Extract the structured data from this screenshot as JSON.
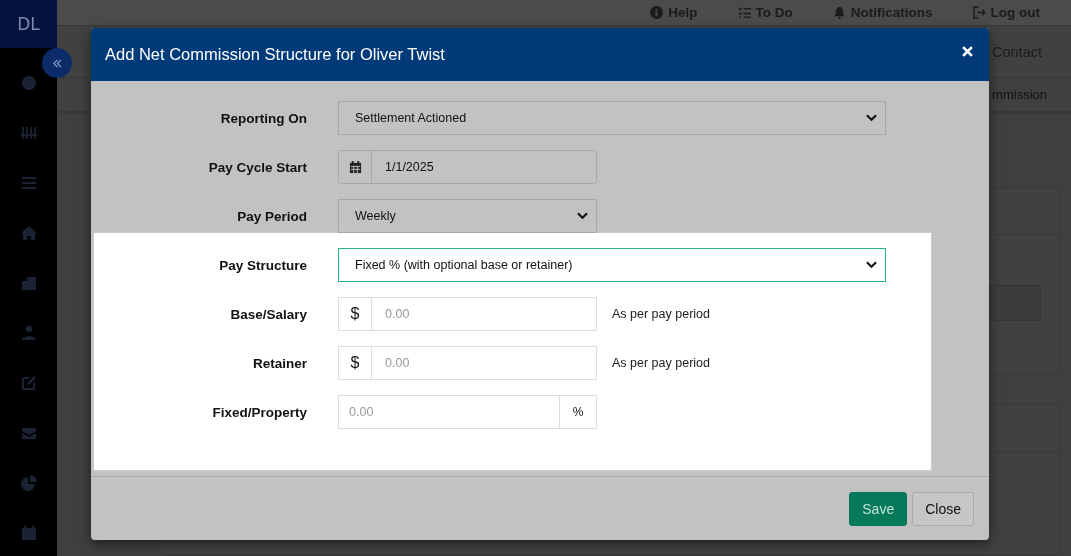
{
  "sidebar": {
    "logo": "DL"
  },
  "top_bar": {
    "links": [
      {
        "kind": "help",
        "label": "Help"
      },
      {
        "kind": "todo",
        "label": "To Do"
      },
      {
        "kind": "bell",
        "label": "Notifications"
      },
      {
        "kind": "logout",
        "label": "Log out"
      }
    ]
  },
  "page": {
    "header_link": "Contact",
    "tab": "mmission"
  },
  "modal": {
    "title": "Add Net Commission Structure for Oliver Twist",
    "fields": [
      {
        "kind": "select",
        "label": "Reporting On",
        "value": "Settlement Actioned",
        "wide": true,
        "focused": false,
        "highlighted": false
      },
      {
        "kind": "date",
        "label": "Pay Cycle Start",
        "value": "1/1/2025",
        "highlighted": false
      },
      {
        "kind": "select",
        "label": "Pay Period",
        "value": "Weekly",
        "wide": false,
        "focused": false,
        "highlighted": false
      },
      {
        "kind": "select",
        "label": "Pay Structure",
        "value": "Fixed % (with optional base or retainer)",
        "wide": true,
        "focused": true,
        "highlighted": true
      },
      {
        "kind": "money",
        "label": "Base/Salary",
        "prefix": "$",
        "placeholder": "0.00",
        "note": "As per pay period",
        "highlighted": true
      },
      {
        "kind": "money",
        "label": "Retainer",
        "prefix": "$",
        "placeholder": "0.00",
        "note": "As per pay period",
        "highlighted": true
      },
      {
        "kind": "percent",
        "label": "Fixed/Property",
        "placeholder": "0.00",
        "suffix": "%",
        "highlighted": true
      }
    ],
    "buttons": [
      {
        "kind": "primary",
        "label": "Save"
      },
      {
        "kind": "secondary",
        "label": "Close"
      }
    ]
  }
}
